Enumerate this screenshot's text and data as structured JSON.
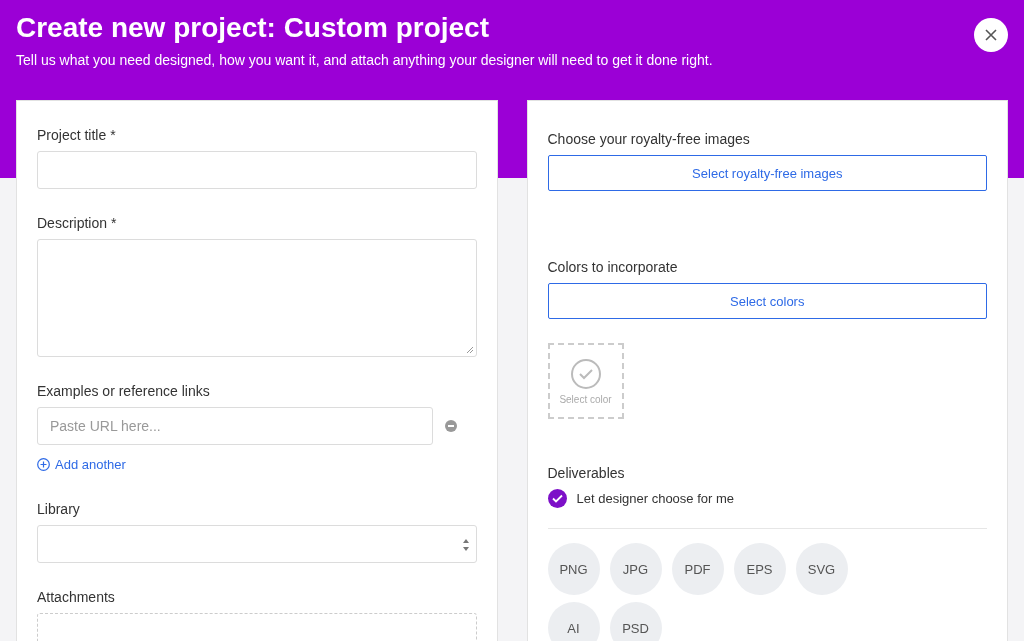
{
  "header": {
    "title": "Create new project: Custom project",
    "subtitle": "Tell us what you need designed, how you want it, and attach anything your designer will need to get it done right."
  },
  "left_form": [
    {
      "kind": "text",
      "label": "Project title *"
    },
    {
      "kind": "textarea",
      "label": "Description *"
    },
    {
      "kind": "links",
      "label": "Examples or reference links",
      "placeholder": "Paste URL here...",
      "add_label": "Add another"
    },
    {
      "kind": "select",
      "label": "Library"
    },
    {
      "kind": "attachments",
      "label": "Attachments"
    }
  ],
  "right_form": {
    "images": {
      "label": "Choose your royalty-free images",
      "button": "Select royalty-free images"
    },
    "colors": {
      "label": "Colors to incorporate",
      "button": "Select colors",
      "tile_label": "Select color"
    },
    "deliverables": {
      "label": "Deliverables",
      "choice": {
        "label": "Let designer choose for me",
        "checked": true
      },
      "formats": [
        "PNG",
        "JPG",
        "PDF",
        "EPS",
        "SVG",
        "AI",
        "PSD"
      ]
    }
  }
}
